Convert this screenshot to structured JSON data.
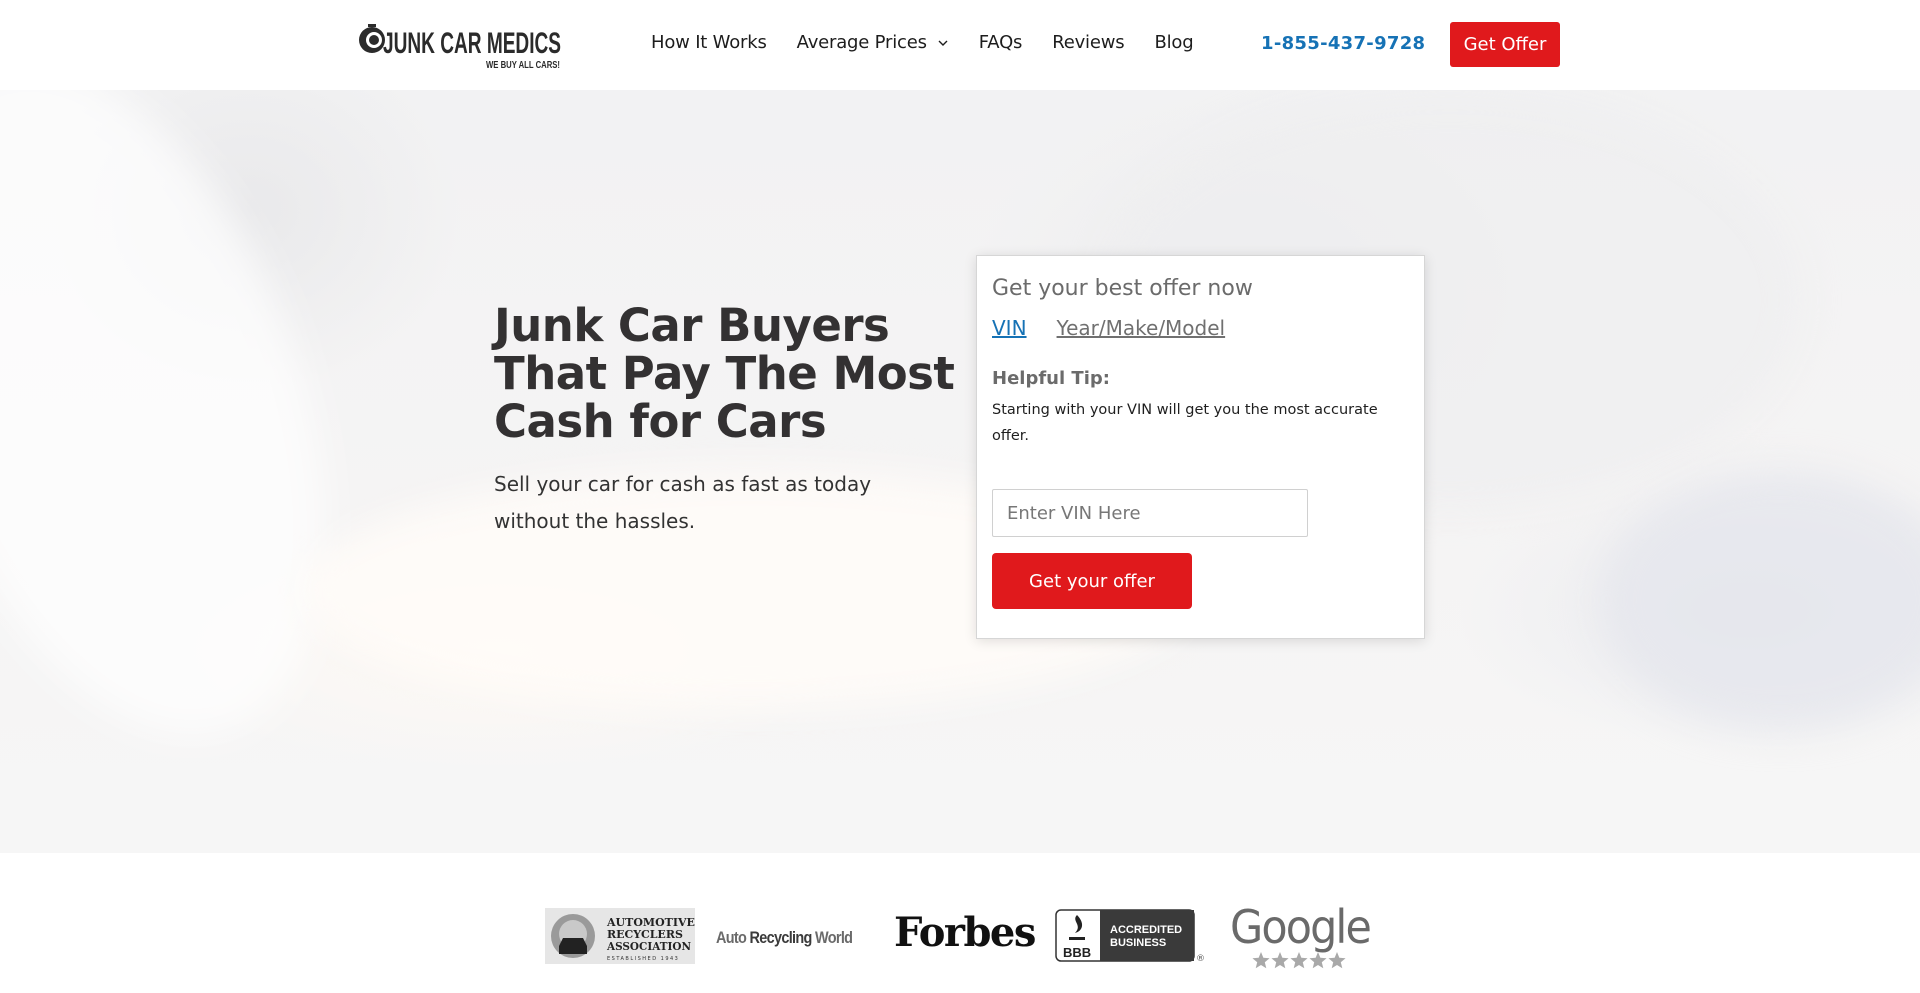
{
  "header": {
    "logo": {
      "brand": "JUNK CAR MEDICS",
      "tagline": "WE BUY ALL CARS!",
      "icon": "tire-icon"
    },
    "nav": [
      {
        "label": "How It Works"
      },
      {
        "label": "Average Prices",
        "has_dropdown": true,
        "icon": "chevron-down-icon"
      },
      {
        "label": "FAQs"
      },
      {
        "label": "Reviews"
      },
      {
        "label": "Blog"
      }
    ],
    "phone": "1-855-437-9728",
    "cta_label": "Get Offer"
  },
  "hero": {
    "title_lines": [
      "Junk Car Buyers",
      "That Pay The Most",
      "Cash for Cars"
    ],
    "subtitle": "Sell your car for cash as fast as today without the hassles."
  },
  "offer_form": {
    "title": "Get your best offer now",
    "tabs": [
      {
        "label": "VIN",
        "active": true
      },
      {
        "label": "Year/Make/Model",
        "active": false
      }
    ],
    "tip_title": "Helpful Tip:",
    "tip_text": "Starting with your VIN will get you the most accurate offer.",
    "vin_input": {
      "value": "",
      "placeholder": "Enter VIN Here"
    },
    "submit_label": "Get your offer"
  },
  "trust_logos": {
    "ara": {
      "line1": "AUTOMOTIVE",
      "line2": "RECYCLERS",
      "line3": "ASSOCIATION",
      "established": "ESTABLISHED 1943"
    },
    "arw": {
      "part1": "Auto",
      "part2": "Recycling",
      "part3": "World"
    },
    "forbes": "Forbes",
    "bbb": {
      "mark": "BBB",
      "line1": "ACCREDITED",
      "line2": "BUSINESS",
      "registered": "®"
    },
    "google": {
      "word": "Google",
      "stars": 5
    }
  },
  "colors": {
    "accent_red": "#e0191c",
    "link_blue": "#1672b5",
    "heading_dark": "#333132"
  }
}
